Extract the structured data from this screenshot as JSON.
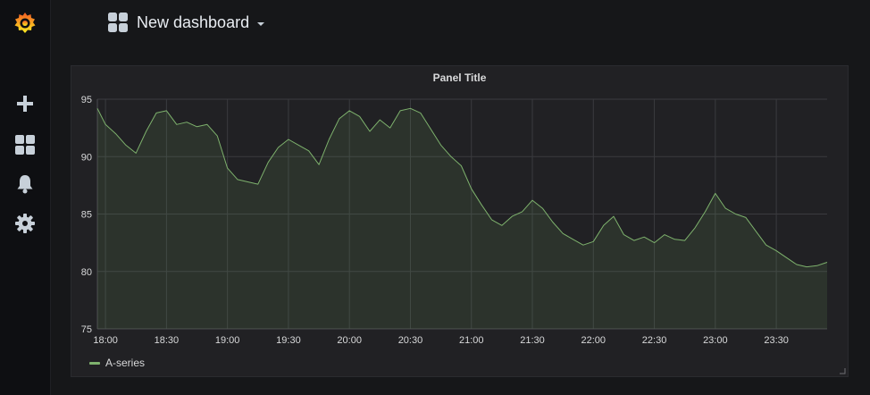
{
  "app": {
    "dashboard_title": "New dashboard"
  },
  "sidebar": {
    "items": [
      {
        "icon": "grafana-logo-icon"
      },
      {
        "icon": "plus-icon"
      },
      {
        "icon": "dashboards-icon"
      },
      {
        "icon": "bell-icon"
      },
      {
        "icon": "gear-icon"
      }
    ]
  },
  "panel": {
    "title": "Panel Title",
    "legend": [
      {
        "name": "A-series",
        "color": "#7eb26d"
      }
    ]
  },
  "chart_data": {
    "type": "area",
    "title": "Panel Title",
    "xlabel": "",
    "ylabel": "",
    "ylim": [
      75,
      95
    ],
    "yticks": [
      75,
      80,
      85,
      90,
      95
    ],
    "x_ticks": [
      "18:00",
      "18:30",
      "19:00",
      "19:30",
      "20:00",
      "20:30",
      "21:00",
      "21:30",
      "22:00",
      "22:30",
      "23:00",
      "23:30"
    ],
    "grid": true,
    "legend_position": "bottom-left",
    "series": [
      {
        "name": "A-series",
        "color": "#7eb26d",
        "x": [
          "17:56",
          "18:00",
          "18:05",
          "18:10",
          "18:15",
          "18:20",
          "18:25",
          "18:30",
          "18:35",
          "18:40",
          "18:45",
          "18:50",
          "18:55",
          "19:00",
          "19:05",
          "19:10",
          "19:15",
          "19:20",
          "19:25",
          "19:30",
          "19:35",
          "19:40",
          "19:45",
          "19:50",
          "19:55",
          "20:00",
          "20:05",
          "20:10",
          "20:15",
          "20:20",
          "20:25",
          "20:30",
          "20:35",
          "20:40",
          "20:45",
          "20:50",
          "20:55",
          "21:00",
          "21:05",
          "21:10",
          "21:15",
          "21:20",
          "21:25",
          "21:30",
          "21:35",
          "21:40",
          "21:45",
          "21:50",
          "21:55",
          "22:00",
          "22:05",
          "22:10",
          "22:15",
          "22:20",
          "22:25",
          "22:30",
          "22:35",
          "22:40",
          "22:45",
          "22:50",
          "22:55",
          "23:00",
          "23:05",
          "23:10",
          "23:15",
          "23:20",
          "23:25",
          "23:30",
          "23:35",
          "23:40",
          "23:45",
          "23:50",
          "23:55"
        ],
        "values": [
          94.2,
          92.8,
          92.0,
          91.0,
          90.3,
          92.2,
          93.8,
          94.0,
          92.8,
          93.0,
          92.6,
          92.8,
          91.8,
          89.0,
          88.0,
          87.8,
          87.6,
          89.5,
          90.8,
          91.5,
          91.0,
          90.5,
          89.3,
          91.5,
          93.3,
          94.0,
          93.5,
          92.2,
          93.2,
          92.5,
          94.0,
          94.2,
          93.8,
          92.4,
          91.0,
          90.0,
          89.2,
          87.2,
          85.8,
          84.5,
          84.0,
          84.8,
          85.2,
          86.2,
          85.5,
          84.3,
          83.3,
          82.8,
          82.3,
          82.6,
          84.0,
          84.8,
          83.2,
          82.7,
          83.0,
          82.5,
          83.2,
          82.8,
          82.7,
          83.8,
          85.2,
          86.8,
          85.5,
          85.0,
          84.7,
          83.5,
          82.3,
          81.8,
          81.2,
          80.6,
          80.4,
          80.5,
          80.8
        ]
      }
    ]
  }
}
